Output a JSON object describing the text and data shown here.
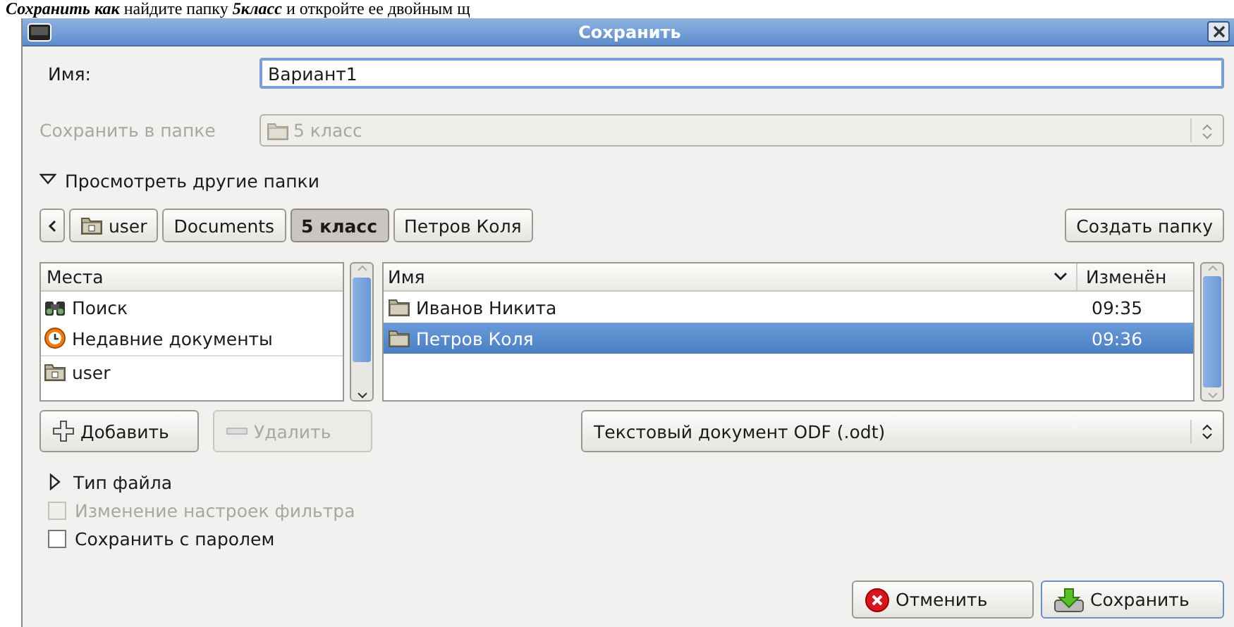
{
  "document_text": "**Сохранить как** найдите папку **5класс** и откройте ее двойным щ",
  "window": {
    "title": "Сохранить"
  },
  "name_field": {
    "label": "Имя:",
    "value": "Вариант1"
  },
  "folder_combo": {
    "label": "Сохранить в папке",
    "value": "5 класс",
    "disabled": true
  },
  "browse_expander": {
    "label": "Просмотреть другие папки",
    "expanded": true
  },
  "path_bar": {
    "items": [
      {
        "label": "user",
        "kind": "home",
        "selected": false
      },
      {
        "label": "Documents",
        "kind": "folder",
        "selected": false
      },
      {
        "label": "5 класс",
        "kind": "folder",
        "selected": true
      },
      {
        "label": "Петров Коля",
        "kind": "folder",
        "selected": false
      }
    ]
  },
  "create_folder": {
    "label": "Создать папку"
  },
  "places": {
    "header": "Места",
    "items": [
      {
        "label": "Поиск",
        "kind": "search"
      },
      {
        "label": "Недавние документы",
        "kind": "recent"
      },
      {
        "label": "user",
        "kind": "home"
      }
    ]
  },
  "files": {
    "columns": [
      "Имя",
      "Изменён"
    ],
    "rows": [
      {
        "name": "Иванов Никита",
        "modified": "09:35",
        "selected": false
      },
      {
        "name": "Петров Коля",
        "modified": "09:36",
        "selected": true
      }
    ]
  },
  "add_button": {
    "label": "Добавить",
    "disabled": false
  },
  "remove_button": {
    "label": "Удалить",
    "disabled": true
  },
  "file_type": {
    "value": "Текстовый документ ODF (.odt)"
  },
  "type_expander": {
    "label": "Тип файла",
    "expanded": false
  },
  "options": [
    {
      "label": "Изменение настроек фильтра",
      "checked": false,
      "disabled": true
    },
    {
      "label": "Сохранить с паролем",
      "checked": false,
      "disabled": false
    }
  ],
  "buttons": [
    {
      "label": "Отменить",
      "kind": "cancel"
    },
    {
      "label": "Сохранить",
      "kind": "save"
    }
  ]
}
